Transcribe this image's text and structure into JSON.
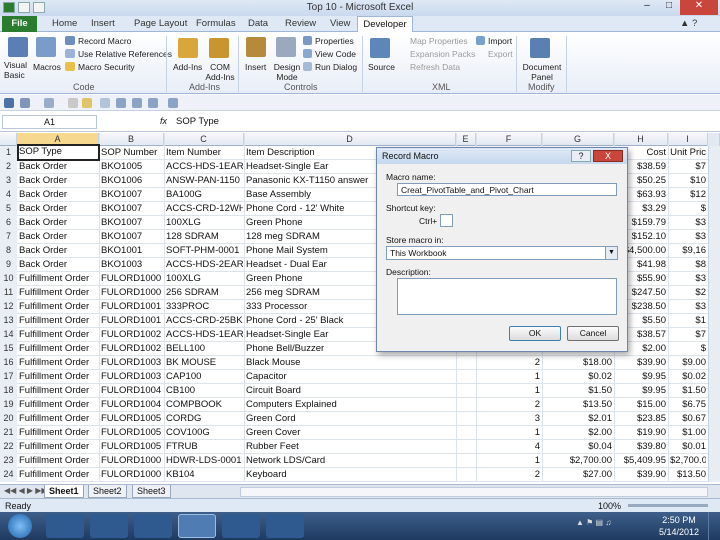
{
  "window": {
    "title": "Top 10 - Microsoft Excel"
  },
  "tabs": [
    "File",
    "Home",
    "Insert",
    "Page Layout",
    "Formulas",
    "Data",
    "Review",
    "View",
    "Developer"
  ],
  "ribbon": {
    "code": {
      "visual_basic": "Visual Basic",
      "macros": "Macros",
      "record_macro": "Record Macro",
      "relative_refs": "Use Relative References",
      "macro_security": "Macro Security",
      "group": "Code"
    },
    "addins": {
      "addins": "Add-Ins",
      "com_addins": "COM Add-Ins",
      "group": "Add-Ins"
    },
    "controls": {
      "insert": "Insert",
      "design_mode": "Design Mode",
      "properties": "Properties",
      "view_code": "View Code",
      "run_dialog": "Run Dialog",
      "group": "Controls"
    },
    "xml": {
      "source": "Source",
      "map_properties": "Map Properties",
      "expansion_packs": "Expansion Packs",
      "refresh_data": "Refresh Data",
      "import": "Import",
      "export": "Export",
      "group": "XML"
    },
    "modify": {
      "document_panel": "Document Panel",
      "group": "Modify"
    }
  },
  "formula_bar": {
    "name_box": "A1",
    "fx": "fx",
    "content": "SOP Type"
  },
  "columns": [
    "A",
    "B",
    "C",
    "D",
    "E",
    "F",
    "G",
    "H",
    "I"
  ],
  "rows": [
    {
      "n": "1",
      "a": "SOP Type",
      "b": "SOP Number",
      "c": "Item Number",
      "d": "Item Description",
      "e": "",
      "f": "",
      "g": "",
      "h": "Cost",
      "i": "Unit Pric"
    },
    {
      "n": "2",
      "a": "Back Order",
      "b": "BKO1005",
      "c": "ACCS-HDS-1EAR",
      "d": "Headset-Single Ear",
      "e": "",
      "f": "",
      "g": "",
      "h": "$38.59",
      "i": "$7"
    },
    {
      "n": "3",
      "a": "Back Order",
      "b": "BKO1006",
      "c": "ANSW-PAN-1150",
      "d": "Panasonic KX-T1150 answer",
      "e": "",
      "f": "",
      "g": "",
      "h": "$50.25",
      "i": "$10"
    },
    {
      "n": "4",
      "a": "Back Order",
      "b": "BKO1007",
      "c": "BA100G",
      "d": "Base Assembly",
      "e": "",
      "f": "",
      "g": "",
      "h": "$63.93",
      "i": "$12"
    },
    {
      "n": "5",
      "a": "Back Order",
      "b": "BKO1007",
      "c": "ACCS-CRD-12WH",
      "d": "Phone Cord - 12' White",
      "e": "",
      "f": "",
      "g": "",
      "h": "$3.29",
      "i": "$"
    },
    {
      "n": "6",
      "a": "Back Order",
      "b": "BKO1007",
      "c": "100XLG",
      "d": "Green Phone",
      "e": "",
      "f": "",
      "g": "",
      "h": "$159.79",
      "i": "$3"
    },
    {
      "n": "7",
      "a": "Back Order",
      "b": "BKO1007",
      "c": "128 SDRAM",
      "d": "128 meg SDRAM",
      "e": "",
      "f": "",
      "g": "",
      "h": "$152.10",
      "i": "$3"
    },
    {
      "n": "8",
      "a": "Back Order",
      "b": "BKO1001",
      "c": "SOFT-PHM-0001",
      "d": "Phone Mail System",
      "e": "",
      "f": "",
      "g": "",
      "h": "$4,500.00",
      "i": "$9,16"
    },
    {
      "n": "9",
      "a": "Back Order",
      "b": "BKO1003",
      "c": "ACCS-HDS-2EAR",
      "d": "Headset - Dual Ear",
      "e": "",
      "f": "",
      "g": "",
      "h": "$41.98",
      "i": "$8"
    },
    {
      "n": "10",
      "a": "Fulfillment Order",
      "b": "FULORD1000",
      "c": "100XLG",
      "d": "Green Phone",
      "e": "",
      "f": "",
      "g": "",
      "h": "$55.90",
      "i": "$3"
    },
    {
      "n": "11",
      "a": "Fulfillment Order",
      "b": "FULORD1000",
      "c": "256 SDRAM",
      "d": "256 meg SDRAM",
      "e": "",
      "f": "",
      "g": "",
      "h": "$247.50",
      "i": "$2"
    },
    {
      "n": "12",
      "a": "Fulfillment Order",
      "b": "FULORD1001",
      "c": "333PROC",
      "d": "333 Processor",
      "e": "",
      "f": "",
      "g": "",
      "h": "$238.50",
      "i": "$3"
    },
    {
      "n": "13",
      "a": "Fulfillment Order",
      "b": "FULORD1001",
      "c": "ACCS-CRD-25BK",
      "d": "Phone Cord - 25' Black",
      "e": "",
      "f": "",
      "g": "",
      "h": "$5.50",
      "i": "$1"
    },
    {
      "n": "14",
      "a": "Fulfillment Order",
      "b": "FULORD1002",
      "c": "ACCS-HDS-1EAR",
      "d": "Headset-Single Ear",
      "e": "",
      "f": "",
      "g": "",
      "h": "$38.57",
      "i": "$7"
    },
    {
      "n": "15",
      "a": "Fulfillment Order",
      "b": "FULORD1002",
      "c": "BELL100",
      "d": "Phone Bell/Buzzer",
      "e": "",
      "f": "",
      "g": "",
      "h": "$2.00",
      "i": "$"
    },
    {
      "n": "16",
      "a": "Fulfillment Order",
      "b": "FULORD1003",
      "c": "BK MOUSE",
      "d": "Black Mouse",
      "e": "",
      "f": "2",
      "g": "$18.00",
      "h": "$39.90",
      "i": "$9.00"
    },
    {
      "n": "17",
      "a": "Fulfillment Order",
      "b": "FULORD1003",
      "c": "CAP100",
      "d": "Capacitor",
      "e": "",
      "f": "1",
      "g": "$0.02",
      "h": "$9.95",
      "i": "$0.02"
    },
    {
      "n": "18",
      "a": "Fulfillment Order",
      "b": "FULORD1004",
      "c": "CB100",
      "d": "Circuit Board",
      "e": "",
      "f": "1",
      "g": "$1.50",
      "h": "$9.95",
      "i": "$1.50"
    },
    {
      "n": "19",
      "a": "Fulfillment Order",
      "b": "FULORD1004",
      "c": "COMPBOOK",
      "d": "Computers Explained",
      "e": "",
      "f": "2",
      "g": "$13.50",
      "h": "$15.00",
      "i": "$6.75"
    },
    {
      "n": "20",
      "a": "Fulfillment Order",
      "b": "FULORD1005",
      "c": "CORDG",
      "d": "Green Cord",
      "e": "",
      "f": "3",
      "g": "$2.01",
      "h": "$23.85",
      "i": "$0.67"
    },
    {
      "n": "21",
      "a": "Fulfillment Order",
      "b": "FULORD1005",
      "c": "COV100G",
      "d": "Green Cover",
      "e": "",
      "f": "1",
      "g": "$2.00",
      "h": "$19.90",
      "i": "$1.00"
    },
    {
      "n": "22",
      "a": "Fulfillment Order",
      "b": "FULORD1005",
      "c": "FTRUB",
      "d": "Rubber Feet",
      "e": "",
      "f": "4",
      "g": "$0.04",
      "h": "$39.80",
      "i": "$0.01"
    },
    {
      "n": "23",
      "a": "Fulfillment Order",
      "b": "FULORD1000",
      "c": "HDWR-LDS-0001",
      "d": "Network LDS/Card",
      "e": "",
      "f": "1",
      "g": "$2,700.00",
      "h": "$5,409.95",
      "i": "$2,700.00"
    },
    {
      "n": "24",
      "a": "Fulfillment Order",
      "b": "FULORD1000",
      "c": "KB104",
      "d": "Keyboard",
      "e": "",
      "f": "2",
      "g": "$27.00",
      "h": "$39.90",
      "i": "$13.50"
    }
  ],
  "sheets": [
    "Sheet1",
    "Sheet2",
    "Sheet3"
  ],
  "status": {
    "ready": "Ready",
    "zoom": "100%"
  },
  "taskbar": {
    "time": "2:50 PM",
    "date": "5/14/2012"
  },
  "dialog": {
    "title": "Record Macro",
    "macro_name_label": "Macro name:",
    "macro_name_value": "Creat_PivotTable_and_Pivot_Chart",
    "shortcut_label": "Shortcut key:",
    "ctrl_label": "Ctrl+",
    "store_label": "Store macro in:",
    "store_value": "This Workbook",
    "description_label": "Description:",
    "ok": "OK",
    "cancel": "Cancel",
    "help": "?",
    "close": "X"
  },
  "colors": {
    "file_tab": "#2a7d2e",
    "ribbon_bg": "#e8eef7",
    "taskbar": "#1f3a60"
  }
}
